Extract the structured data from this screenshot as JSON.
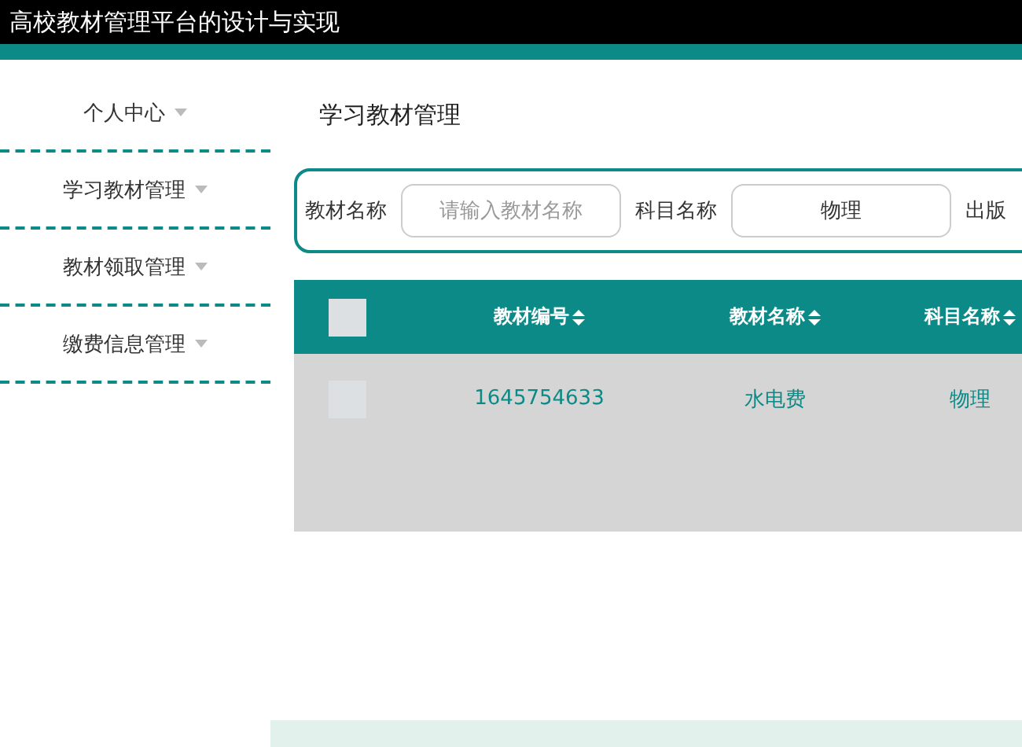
{
  "header": {
    "title": "高校教材管理平台的设计与实现"
  },
  "sidebar": {
    "items": [
      {
        "label": "个人中心"
      },
      {
        "label": "学习教材管理"
      },
      {
        "label": "教材领取管理"
      },
      {
        "label": "缴费信息管理"
      }
    ]
  },
  "page_title": "学习教材管理",
  "search": {
    "fields": [
      {
        "label": "教材名称",
        "placeholder": "请输入教材名称"
      },
      {
        "label": "科目名称",
        "value": "物理"
      },
      {
        "label": "出版"
      }
    ]
  },
  "table": {
    "select_all": {
      "checked": false
    },
    "columns": [
      "教材编号",
      "教材名称",
      "科目名称"
    ],
    "rows": [
      {
        "checked": false,
        "cells": [
          "1645754633",
          "水电费",
          "物理"
        ]
      }
    ]
  }
}
